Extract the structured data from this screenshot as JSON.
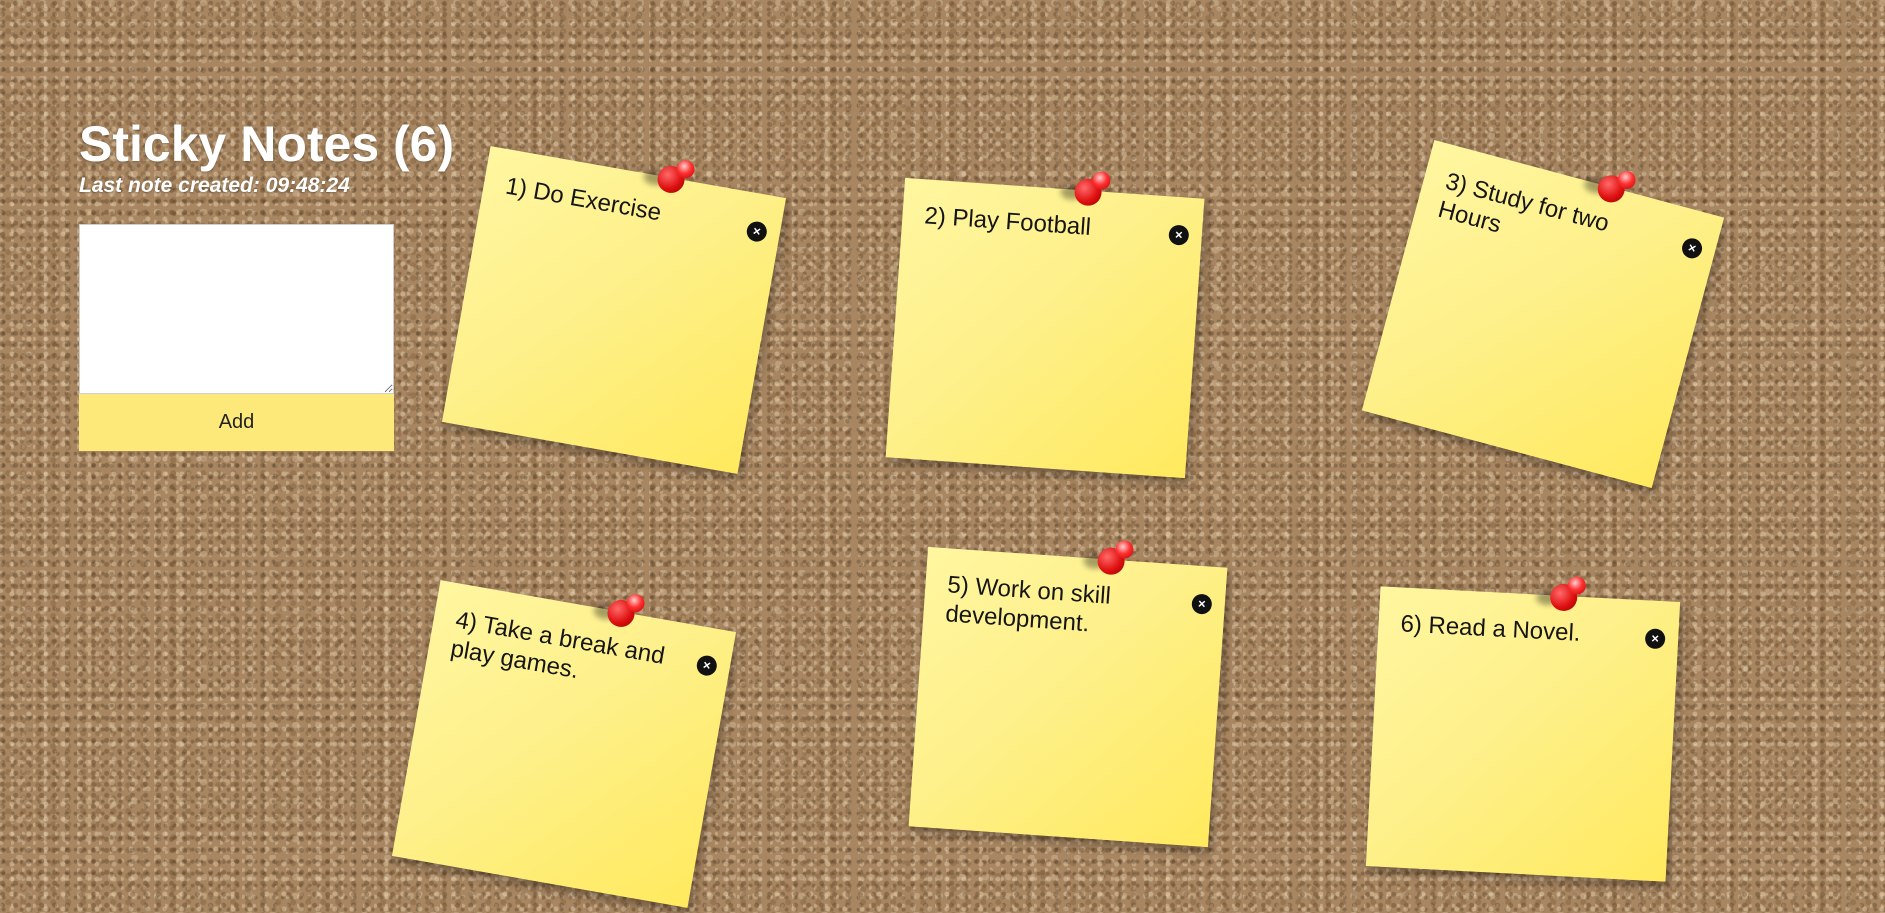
{
  "header": {
    "title": "Sticky Notes (6)",
    "last_created": "Last note created: 09:48:24"
  },
  "form": {
    "textarea_value": "",
    "add_label": "Add"
  },
  "colors": {
    "note_yellow": "#fef08a",
    "button_yellow": "#fde97a",
    "pin_red": "#e01010",
    "cork": "#a88661"
  },
  "notes": [
    {
      "text": "1) Do Exercise",
      "close_glyph": "×"
    },
    {
      "text": "2) Play Football",
      "close_glyph": "×"
    },
    {
      "text": "3) Study for two Hours",
      "close_glyph": "×"
    },
    {
      "text": "4) Take a break and play games.",
      "close_glyph": "×"
    },
    {
      "text": "5) Work on skill development.",
      "close_glyph": "×"
    },
    {
      "text": "6) Read a Novel.",
      "close_glyph": "×"
    }
  ]
}
